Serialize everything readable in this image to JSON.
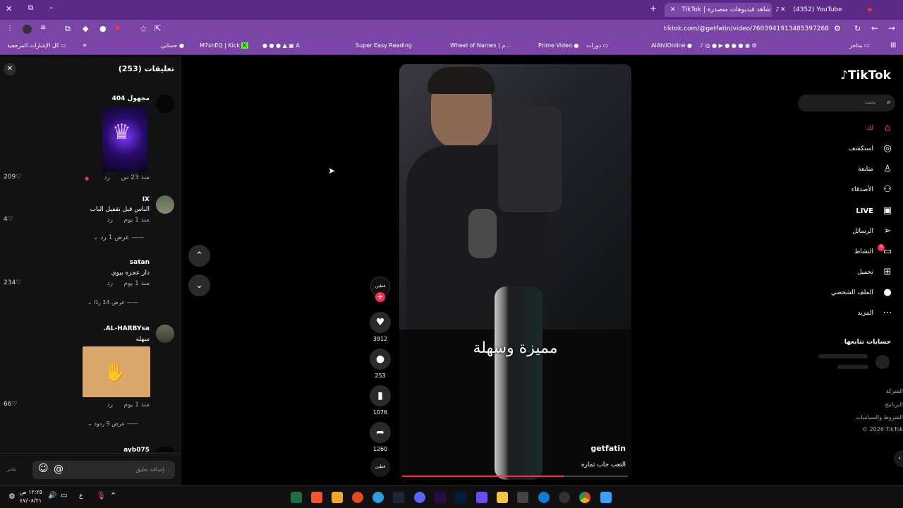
{
  "browser": {
    "tabs": [
      {
        "label": "(4352) YouTube"
      },
      {
        "label": "TikTok | شاهد فيديوهات متصدرة"
      }
    ],
    "url": "tiktok.com/@getfatin/video/7603941913485397268",
    "bookmarks": [
      "متاجر",
      "AlAhliOnline",
      "دورات",
      "Prime Video",
      "Wheel of Names | م...",
      "Super Easy Reading",
      "M7snEQ | Kick",
      "حسابي",
      "كل الإشارات المرجعية"
    ]
  },
  "comments_panel": {
    "title": "تعليقات (253)",
    "items": [
      {
        "user": "مجهول 404",
        "text": "",
        "time": "منذ 23 س",
        "reply": "رد",
        "likes": "209",
        "has_image": true,
        "image": "brain-crown-icon"
      },
      {
        "user": "IX",
        "text": "الناس قبل تقفيل الباب",
        "time": "منذ 1 يوم",
        "reply": "رد",
        "likes": "4",
        "view_replies": "عرض 1 رد"
      },
      {
        "user": "satan",
        "text": "دار عجزه بيوي",
        "time": "منذ 1 يوم",
        "reply": "رد",
        "likes": "234",
        "view_replies": "عرض 14 ردًا"
      },
      {
        "user": "AL-HARBYsa.",
        "text": "سهله",
        "time": "منذ 1 يوم",
        "reply": "رد",
        "likes": "66",
        "has_image": true,
        "image": "hand-card-icon",
        "view_replies": "عرض 9 ردود"
      },
      {
        "user": "ayb075",
        "text": "",
        "time": "",
        "reply": "",
        "likes": ""
      }
    ],
    "input_placeholder": "إضافة تعليق...",
    "post_label": "نشر"
  },
  "video": {
    "caption": "مميزة وسهلة",
    "author": "getfatin",
    "description": "التعب جاب ثماره",
    "progress": 0.72,
    "avatar_label": "فطين",
    "actions": {
      "likes": "3912",
      "comments": "253",
      "saves": "1076",
      "shares": "1260"
    }
  },
  "sidebar": {
    "logo": "TikTok",
    "search_placeholder": "بحث",
    "nav": [
      {
        "label": "لك",
        "icon": "home-icon",
        "active": true
      },
      {
        "label": "استكشف",
        "icon": "compass-icon"
      },
      {
        "label": "متابعة",
        "icon": "user-follow-icon"
      },
      {
        "label": "الأصدقاء",
        "icon": "friends-icon"
      },
      {
        "label": "LIVE",
        "icon": "live-icon"
      },
      {
        "label": "الرسائل",
        "icon": "send-icon"
      },
      {
        "label": "النشاط",
        "icon": "activity-icon",
        "badge": "3"
      },
      {
        "label": "تحميل",
        "icon": "upload-icon"
      },
      {
        "label": "الملف الشخصي",
        "icon": "profile-avatar-icon"
      },
      {
        "label": "المزيد",
        "icon": "more-icon"
      }
    ],
    "following_title": "حسابات تتابعها",
    "footer": [
      "الشركة",
      "البرنامج",
      "الشروط والسياسات",
      "© 2026 TikTok"
    ]
  },
  "taskbar": {
    "time": "١٢:٢٥ ص",
    "date": "٤٧/٠٨/٢١",
    "lang": "ع"
  },
  "colors": {
    "accent": "#fe2c55",
    "browser": "#7b45a8",
    "tabbar": "#5b2a86"
  }
}
